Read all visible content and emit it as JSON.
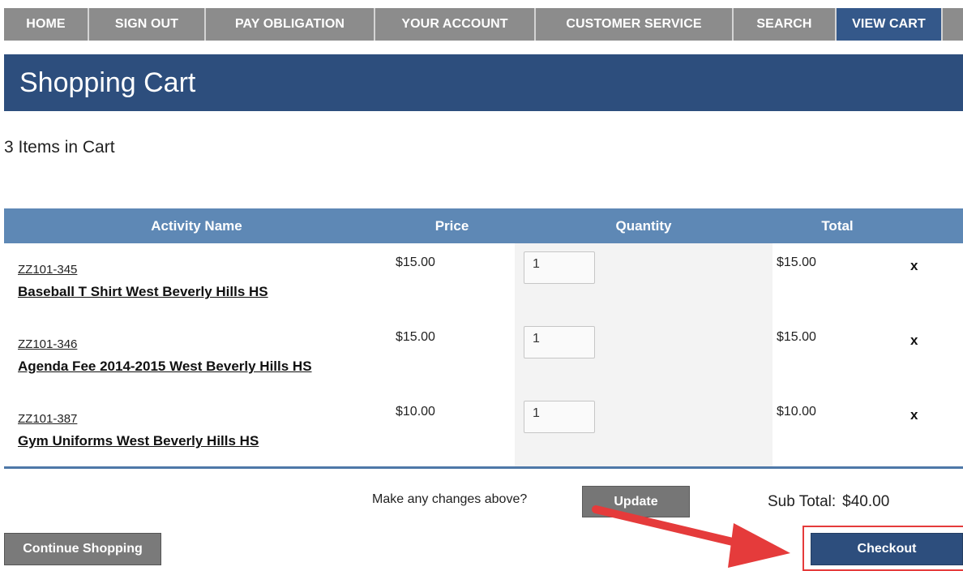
{
  "nav": {
    "items": [
      {
        "label": "HOME",
        "name": "nav-home"
      },
      {
        "label": "SIGN OUT",
        "name": "nav-sign-out"
      },
      {
        "label": "PAY OBLIGATION",
        "name": "nav-pay-obligation"
      },
      {
        "label": "YOUR ACCOUNT",
        "name": "nav-your-account"
      },
      {
        "label": "CUSTOMER SERVICE",
        "name": "nav-customer-service"
      },
      {
        "label": "SEARCH",
        "name": "nav-search"
      },
      {
        "label": "VIEW CART",
        "name": "nav-view-cart",
        "active": true
      }
    ]
  },
  "page": {
    "title": "Shopping Cart",
    "item_count": "3 Items in Cart"
  },
  "table": {
    "headers": {
      "activity": "Activity Name",
      "price": "Price",
      "quantity": "Quantity",
      "total": "Total"
    },
    "rows": [
      {
        "code": "ZZ101-345",
        "name": "Baseball T Shirt West Beverly Hills HS",
        "price": "$15.00",
        "quantity": "1",
        "total": "$15.00",
        "remove": "x"
      },
      {
        "code": "ZZ101-346",
        "name": "Agenda Fee 2014-2015 West Beverly Hills HS",
        "price": "$15.00",
        "quantity": "1",
        "total": "$15.00",
        "remove": "x"
      },
      {
        "code": "ZZ101-387",
        "name": "Gym Uniforms West Beverly Hills HS",
        "price": "$10.00",
        "quantity": "1",
        "total": "$10.00",
        "remove": "x"
      }
    ]
  },
  "footer": {
    "changes_prompt": "Make any changes above?",
    "update_label": "Update",
    "subtotal_label": "Sub Total:",
    "subtotal_value": "$40.00",
    "continue_label": "Continue Shopping",
    "checkout_label": "Checkout"
  },
  "colors": {
    "nav_bg": "#8c8c8c",
    "nav_active": "#34588a",
    "banner": "#2d4e7d",
    "table_header": "#5e88b5",
    "annotation_arrow": "#e53b3b"
  }
}
